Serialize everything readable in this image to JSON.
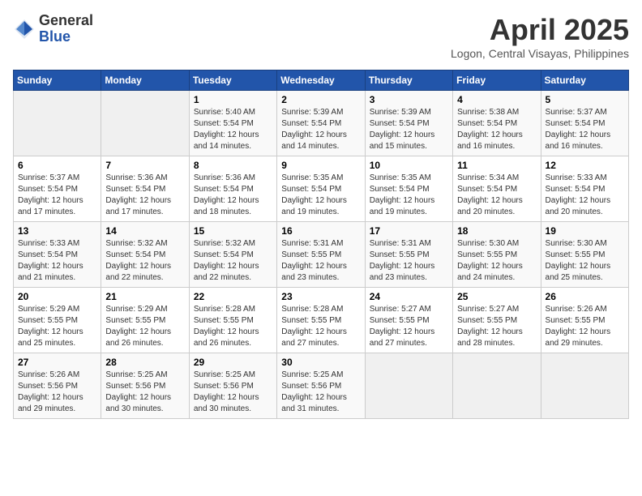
{
  "logo": {
    "general": "General",
    "blue": "Blue"
  },
  "title": {
    "month": "April 2025",
    "location": "Logon, Central Visayas, Philippines"
  },
  "headers": [
    "Sunday",
    "Monday",
    "Tuesday",
    "Wednesday",
    "Thursday",
    "Friday",
    "Saturday"
  ],
  "weeks": [
    [
      {
        "day": "",
        "sunrise": "",
        "sunset": "",
        "daylight": ""
      },
      {
        "day": "",
        "sunrise": "",
        "sunset": "",
        "daylight": ""
      },
      {
        "day": "1",
        "sunrise": "Sunrise: 5:40 AM",
        "sunset": "Sunset: 5:54 PM",
        "daylight": "Daylight: 12 hours and 14 minutes."
      },
      {
        "day": "2",
        "sunrise": "Sunrise: 5:39 AM",
        "sunset": "Sunset: 5:54 PM",
        "daylight": "Daylight: 12 hours and 14 minutes."
      },
      {
        "day": "3",
        "sunrise": "Sunrise: 5:39 AM",
        "sunset": "Sunset: 5:54 PM",
        "daylight": "Daylight: 12 hours and 15 minutes."
      },
      {
        "day": "4",
        "sunrise": "Sunrise: 5:38 AM",
        "sunset": "Sunset: 5:54 PM",
        "daylight": "Daylight: 12 hours and 16 minutes."
      },
      {
        "day": "5",
        "sunrise": "Sunrise: 5:37 AM",
        "sunset": "Sunset: 5:54 PM",
        "daylight": "Daylight: 12 hours and 16 minutes."
      }
    ],
    [
      {
        "day": "6",
        "sunrise": "Sunrise: 5:37 AM",
        "sunset": "Sunset: 5:54 PM",
        "daylight": "Daylight: 12 hours and 17 minutes."
      },
      {
        "day": "7",
        "sunrise": "Sunrise: 5:36 AM",
        "sunset": "Sunset: 5:54 PM",
        "daylight": "Daylight: 12 hours and 17 minutes."
      },
      {
        "day": "8",
        "sunrise": "Sunrise: 5:36 AM",
        "sunset": "Sunset: 5:54 PM",
        "daylight": "Daylight: 12 hours and 18 minutes."
      },
      {
        "day": "9",
        "sunrise": "Sunrise: 5:35 AM",
        "sunset": "Sunset: 5:54 PM",
        "daylight": "Daylight: 12 hours and 19 minutes."
      },
      {
        "day": "10",
        "sunrise": "Sunrise: 5:35 AM",
        "sunset": "Sunset: 5:54 PM",
        "daylight": "Daylight: 12 hours and 19 minutes."
      },
      {
        "day": "11",
        "sunrise": "Sunrise: 5:34 AM",
        "sunset": "Sunset: 5:54 PM",
        "daylight": "Daylight: 12 hours and 20 minutes."
      },
      {
        "day": "12",
        "sunrise": "Sunrise: 5:33 AM",
        "sunset": "Sunset: 5:54 PM",
        "daylight": "Daylight: 12 hours and 20 minutes."
      }
    ],
    [
      {
        "day": "13",
        "sunrise": "Sunrise: 5:33 AM",
        "sunset": "Sunset: 5:54 PM",
        "daylight": "Daylight: 12 hours and 21 minutes."
      },
      {
        "day": "14",
        "sunrise": "Sunrise: 5:32 AM",
        "sunset": "Sunset: 5:54 PM",
        "daylight": "Daylight: 12 hours and 22 minutes."
      },
      {
        "day": "15",
        "sunrise": "Sunrise: 5:32 AM",
        "sunset": "Sunset: 5:54 PM",
        "daylight": "Daylight: 12 hours and 22 minutes."
      },
      {
        "day": "16",
        "sunrise": "Sunrise: 5:31 AM",
        "sunset": "Sunset: 5:55 PM",
        "daylight": "Daylight: 12 hours and 23 minutes."
      },
      {
        "day": "17",
        "sunrise": "Sunrise: 5:31 AM",
        "sunset": "Sunset: 5:55 PM",
        "daylight": "Daylight: 12 hours and 23 minutes."
      },
      {
        "day": "18",
        "sunrise": "Sunrise: 5:30 AM",
        "sunset": "Sunset: 5:55 PM",
        "daylight": "Daylight: 12 hours and 24 minutes."
      },
      {
        "day": "19",
        "sunrise": "Sunrise: 5:30 AM",
        "sunset": "Sunset: 5:55 PM",
        "daylight": "Daylight: 12 hours and 25 minutes."
      }
    ],
    [
      {
        "day": "20",
        "sunrise": "Sunrise: 5:29 AM",
        "sunset": "Sunset: 5:55 PM",
        "daylight": "Daylight: 12 hours and 25 minutes."
      },
      {
        "day": "21",
        "sunrise": "Sunrise: 5:29 AM",
        "sunset": "Sunset: 5:55 PM",
        "daylight": "Daylight: 12 hours and 26 minutes."
      },
      {
        "day": "22",
        "sunrise": "Sunrise: 5:28 AM",
        "sunset": "Sunset: 5:55 PM",
        "daylight": "Daylight: 12 hours and 26 minutes."
      },
      {
        "day": "23",
        "sunrise": "Sunrise: 5:28 AM",
        "sunset": "Sunset: 5:55 PM",
        "daylight": "Daylight: 12 hours and 27 minutes."
      },
      {
        "day": "24",
        "sunrise": "Sunrise: 5:27 AM",
        "sunset": "Sunset: 5:55 PM",
        "daylight": "Daylight: 12 hours and 27 minutes."
      },
      {
        "day": "25",
        "sunrise": "Sunrise: 5:27 AM",
        "sunset": "Sunset: 5:55 PM",
        "daylight": "Daylight: 12 hours and 28 minutes."
      },
      {
        "day": "26",
        "sunrise": "Sunrise: 5:26 AM",
        "sunset": "Sunset: 5:55 PM",
        "daylight": "Daylight: 12 hours and 29 minutes."
      }
    ],
    [
      {
        "day": "27",
        "sunrise": "Sunrise: 5:26 AM",
        "sunset": "Sunset: 5:56 PM",
        "daylight": "Daylight: 12 hours and 29 minutes."
      },
      {
        "day": "28",
        "sunrise": "Sunrise: 5:25 AM",
        "sunset": "Sunset: 5:56 PM",
        "daylight": "Daylight: 12 hours and 30 minutes."
      },
      {
        "day": "29",
        "sunrise": "Sunrise: 5:25 AM",
        "sunset": "Sunset: 5:56 PM",
        "daylight": "Daylight: 12 hours and 30 minutes."
      },
      {
        "day": "30",
        "sunrise": "Sunrise: 5:25 AM",
        "sunset": "Sunset: 5:56 PM",
        "daylight": "Daylight: 12 hours and 31 minutes."
      },
      {
        "day": "",
        "sunrise": "",
        "sunset": "",
        "daylight": ""
      },
      {
        "day": "",
        "sunrise": "",
        "sunset": "",
        "daylight": ""
      },
      {
        "day": "",
        "sunrise": "",
        "sunset": "",
        "daylight": ""
      }
    ]
  ]
}
